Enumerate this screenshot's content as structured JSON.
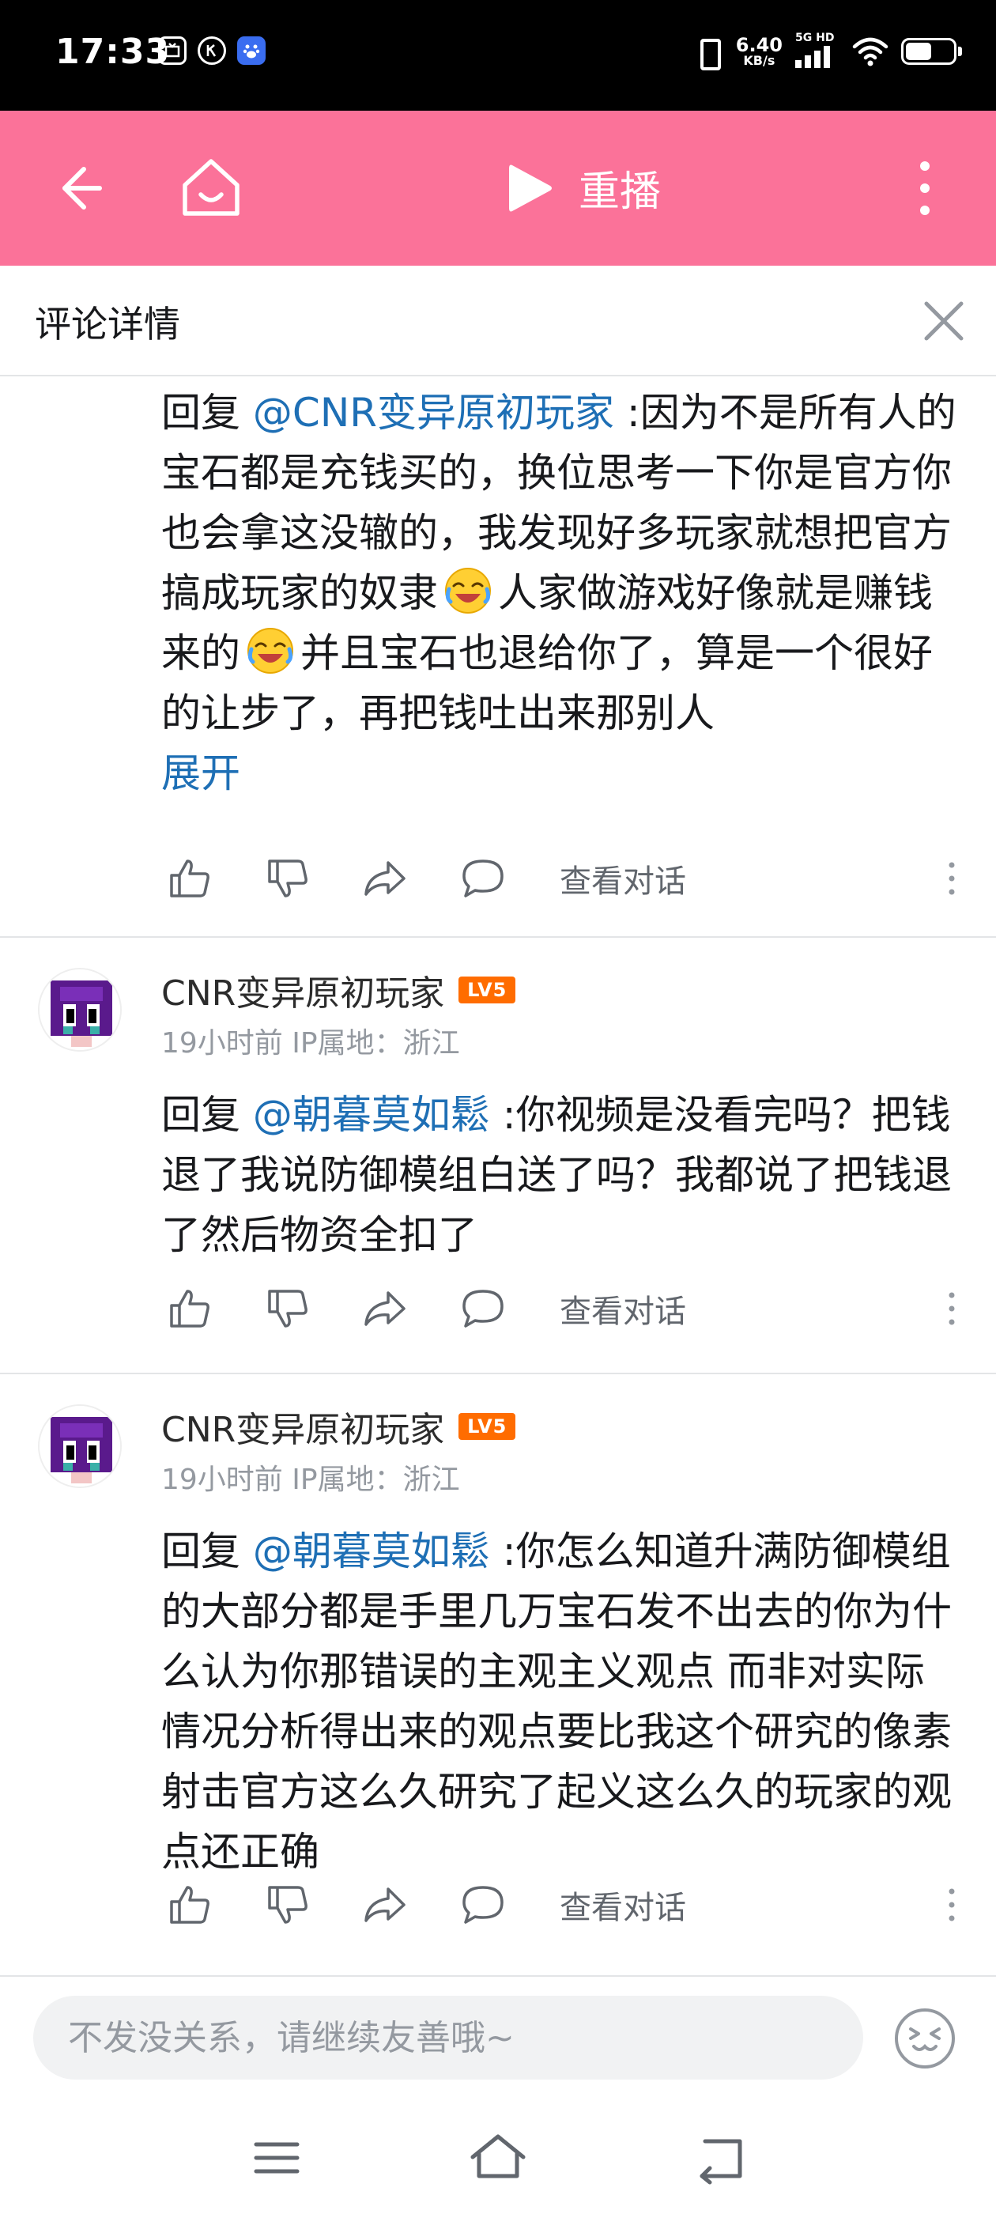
{
  "status_bar": {
    "time": "17:33",
    "net_speed": "6.40",
    "net_unit": "KB/s",
    "signal_label": "5G HD",
    "battery_level": 0.55,
    "left_icons": [
      "tv-icon",
      "k-icon",
      "baidu-icon"
    ]
  },
  "topbar": {
    "replay_label": "重播",
    "color": "#fb7299"
  },
  "panel": {
    "title": "评论详情"
  },
  "comments": [
    {
      "content_parts": {
        "reply_prefix": "回复 ",
        "mention": "@CNR变异原初玩家",
        "text_a": " :因为不是所有人的宝石都是充钱买的，换位思考一下你是官方你也会拿这没辙的，我发现好多玩家就想把官方搞成玩家的奴隶",
        "text_b": "人家做游戏好像就是赚钱来的",
        "text_c": "并且宝石也退给你了，算是一个很好的让步了，再把钱吐出来那别人",
        "expand": "展开"
      },
      "view_convo": "查看对话"
    },
    {
      "username": "CNR变异原初玩家",
      "level": "LV5",
      "meta": "19小时前 IP属地：浙江",
      "content_parts": {
        "reply_prefix": "回复 ",
        "mention": "@朝暮莫如鬆",
        "text": " :你视频是没看完吗？把钱退了我说防御模组白送了吗？我都说了把钱退了然后物资全扣了"
      },
      "view_convo": "查看对话"
    },
    {
      "username": "CNR变异原初玩家",
      "level": "LV5",
      "meta": "19小时前 IP属地：浙江",
      "content_parts": {
        "reply_prefix": "回复 ",
        "mention": "@朝暮莫如鬆",
        "text": " :你怎么知道升满防御模组的大部分都是手里几万宝石发不出去的你为什么认为你那错误的主观主义观点 而非对实际情况分析得出来的观点要比我这个研究的像素射击官方这么久研究了起义这么久的玩家的观点还正确"
      },
      "view_convo": "查看对话"
    }
  ],
  "reply_box": {
    "placeholder": "不发没关系，请继续友善哦~"
  },
  "colors": {
    "accent": "#fb7299",
    "link": "#1e6fb5",
    "level_badge": "#ff6c00",
    "meta": "#9499a0"
  }
}
